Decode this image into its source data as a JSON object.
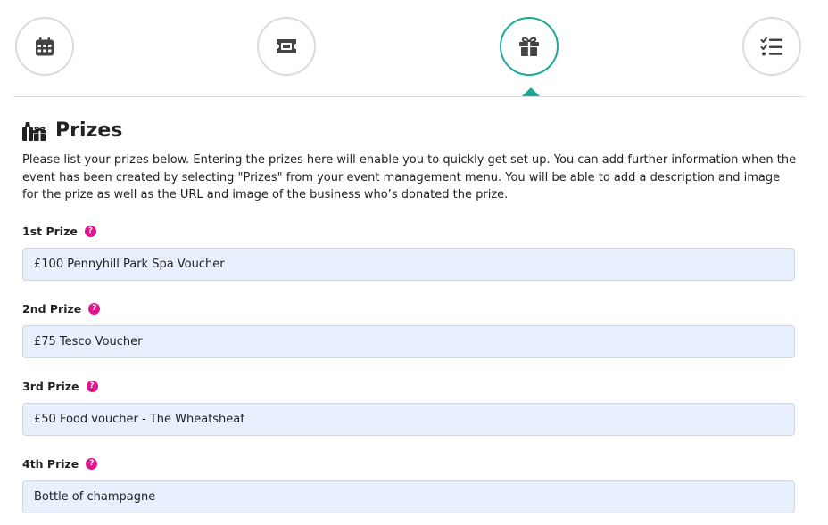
{
  "stepper": {
    "steps": [
      {
        "icon": "calendar-icon",
        "active": false
      },
      {
        "icon": "ticket-icon",
        "active": false
      },
      {
        "icon": "gift-icon",
        "active": true
      },
      {
        "icon": "checklist-icon",
        "active": false
      }
    ],
    "accent_color": "#1aab9b"
  },
  "section": {
    "title": "Prizes",
    "icon": "gifts-icon",
    "intro": "Please list your prizes below. Entering the prizes here will enable you to quickly get set up. You can add further information when the event has been created by selecting \"Prizes\" from your event management menu. You will be able to add a description and image for the prize as well as the URL and image of the business who’s donated the prize."
  },
  "prizes": [
    {
      "label": "1st Prize",
      "value": "£100 Pennyhill Park Spa Voucher"
    },
    {
      "label": "2nd Prize",
      "value": "£75 Tesco Voucher"
    },
    {
      "label": "3rd Prize",
      "value": "£50 Food voucher - The Wheatsheaf"
    },
    {
      "label": "4th Prize",
      "value": "Bottle of champagne"
    }
  ],
  "help_badge": {
    "glyph": "?",
    "color": "#e0148d"
  }
}
